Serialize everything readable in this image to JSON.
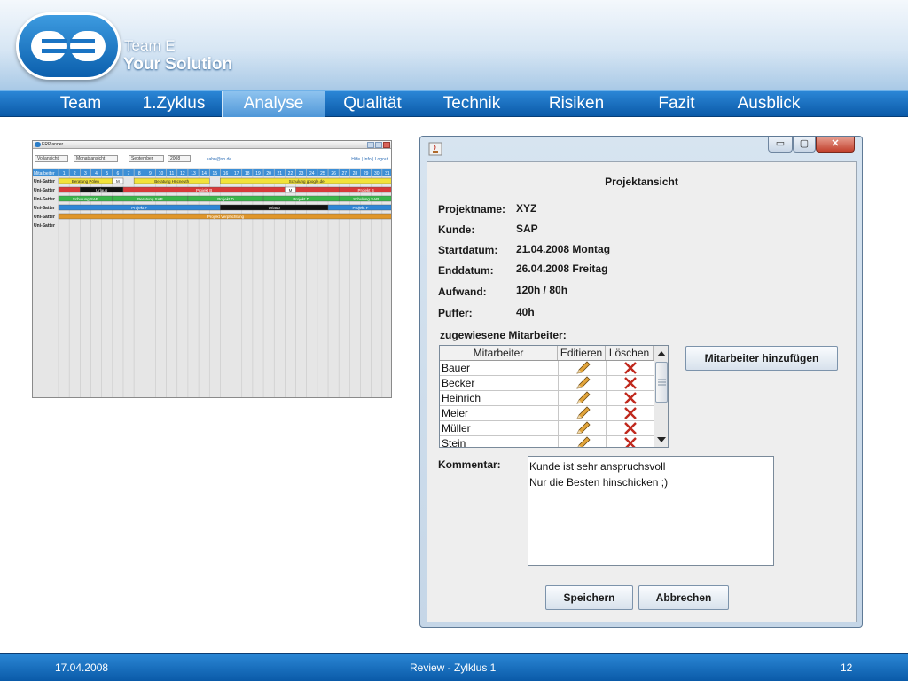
{
  "brand": {
    "line1": "Team E",
    "line2": "Your Solution"
  },
  "nav": {
    "items": [
      "Team",
      "1.Zyklus",
      "Analyse",
      "Qualität",
      "Technik",
      "Risiken",
      "Fazit",
      "Ausblick"
    ],
    "active": "Analyse"
  },
  "planner": {
    "title": "ERPlanner",
    "selects": [
      "Vollansicht",
      "Monatsansicht",
      "September",
      "2008"
    ],
    "email": "sahn@xo.de",
    "links": "Hilfe | Info | Logout",
    "header_label": "Mitarbeiter",
    "days": [
      "1",
      "2",
      "3",
      "4",
      "5",
      "6",
      "7",
      "8",
      "9",
      "10",
      "11",
      "12",
      "13",
      "14",
      "15",
      "16",
      "17",
      "18",
      "19",
      "20",
      "21",
      "22",
      "23",
      "24",
      "25",
      "26",
      "27",
      "28",
      "29",
      "30",
      "31"
    ],
    "rows": [
      "Uni-Satter",
      "Uni-Satter",
      "Uni-Satter",
      "Uni-Satter",
      "Uni-Satter",
      "Uni-Satter"
    ],
    "bars": [
      {
        "row": 0,
        "start": 1,
        "end": 5,
        "color": "#f2e23a",
        "label": "Beratung Pölen"
      },
      {
        "row": 0,
        "start": 6,
        "end": 6,
        "color": "#ffffff",
        "label": "M"
      },
      {
        "row": 0,
        "start": 8,
        "end": 14,
        "color": "#f2e23a",
        "label": "Beratung Hücneuth"
      },
      {
        "row": 0,
        "start": 16,
        "end": 31,
        "color": "#f2e23a",
        "label": "Schulung google.de"
      },
      {
        "row": 1,
        "start": 1,
        "end": 2,
        "color": "#d73a3a",
        "label": ""
      },
      {
        "row": 1,
        "start": 3,
        "end": 6,
        "color": "#111111",
        "label": "Urlaub"
      },
      {
        "row": 1,
        "start": 7,
        "end": 21,
        "color": "#d73a3a",
        "label": "Projekt B"
      },
      {
        "row": 1,
        "start": 22,
        "end": 22,
        "color": "#ffffff",
        "label": "M"
      },
      {
        "row": 1,
        "start": 23,
        "end": 26,
        "color": "#d73a3a",
        "label": ""
      },
      {
        "row": 1,
        "start": 27,
        "end": 31,
        "color": "#d73a3a",
        "label": "Projekt B"
      },
      {
        "row": 2,
        "start": 1,
        "end": 5,
        "color": "#3ab54a",
        "label": "Schulung SAP"
      },
      {
        "row": 2,
        "start": 6,
        "end": 12,
        "color": "#3ab54a",
        "label": "Beratung SAP"
      },
      {
        "row": 2,
        "start": 13,
        "end": 19,
        "color": "#3ab54a",
        "label": "Projekt D"
      },
      {
        "row": 2,
        "start": 20,
        "end": 26,
        "color": "#3ab54a",
        "label": "Projekt D"
      },
      {
        "row": 2,
        "start": 27,
        "end": 31,
        "color": "#3ab54a",
        "label": "Schulung SAP"
      },
      {
        "row": 3,
        "start": 1,
        "end": 15,
        "color": "#2f86d6",
        "label": "Projekt F"
      },
      {
        "row": 3,
        "start": 16,
        "end": 25,
        "color": "#111111",
        "label": "Urlaub"
      },
      {
        "row": 3,
        "start": 26,
        "end": 31,
        "color": "#2f86d6",
        "label": "Projekt F"
      },
      {
        "row": 4,
        "start": 1,
        "end": 31,
        "color": "#e0962a",
        "label": "Projekt Verpflichtung"
      }
    ]
  },
  "dialog": {
    "title": "Projektansicht",
    "fields": [
      {
        "label": "Projektname:",
        "value": "XYZ"
      },
      {
        "label": "Kunde:",
        "value": "SAP"
      },
      {
        "label": "Startdatum:",
        "value": "21.04.2008 Montag"
      },
      {
        "label": "Enddatum:",
        "value": "26.04.2008 Freitag"
      },
      {
        "label": "Aufwand:",
        "value": "120h / 80h"
      },
      {
        "label": "Puffer:",
        "value": "40h"
      }
    ],
    "assigned_label": "zugewiesene Mitarbeiter:",
    "table": {
      "headers": [
        "Mitarbeiter",
        "Editieren",
        "Löschen"
      ],
      "rows": [
        "Bauer",
        "Becker",
        "Heinrich",
        "Meier",
        "Müller",
        "Stein"
      ]
    },
    "add_button": "Mitarbeiter hinzufügen",
    "comment_label": "Kommentar:",
    "comment_lines": [
      "Kunde ist sehr anspruchsvoll",
      "Nur die Besten hinschicken ;)"
    ],
    "save_button": "Speichern",
    "cancel_button": "Abbrechen",
    "icons": {
      "edit": "pencil-icon",
      "delete": "red-x-icon"
    }
  },
  "footer": {
    "date": "17.04.2008",
    "center": "Review - Zylklus 1",
    "page": "12"
  }
}
